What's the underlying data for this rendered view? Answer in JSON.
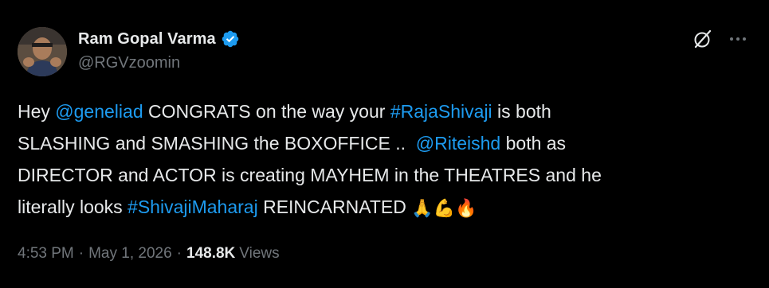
{
  "author": {
    "display_name": "Ram Gopal Varma",
    "handle": "@RGVzoomin",
    "verified": true
  },
  "tweet": {
    "lines": [
      [
        {
          "text": "Hey ",
          "type": "text"
        },
        {
          "text": "@geneliad",
          "type": "link"
        },
        {
          "text": " CONGRATS on the way your ",
          "type": "text"
        },
        {
          "text": "#RajaShivaji",
          "type": "link"
        },
        {
          "text": " is both",
          "type": "text"
        }
      ],
      [
        {
          "text": "SLASHING and SMASHING the BOXOFFICE ..  ",
          "type": "text"
        },
        {
          "text": "@Riteishd",
          "type": "link"
        },
        {
          "text": " both as",
          "type": "text"
        }
      ],
      [
        {
          "text": "DIRECTOR and ACTOR is creating MAYHEM in the THEATRES and he",
          "type": "text"
        }
      ],
      [
        {
          "text": "literally looks ",
          "type": "text"
        },
        {
          "text": "#ShivajiMaharaj",
          "type": "link"
        },
        {
          "text": " REINCARNATED ",
          "type": "text"
        },
        {
          "text": "🙏💪🔥",
          "type": "emoji"
        }
      ]
    ]
  },
  "meta": {
    "time": "4:53 PM",
    "separator": "·",
    "date": "May 1, 2026",
    "views_count": "148.8K",
    "views_label": "Views"
  },
  "icons": {
    "verified": "verified-badge-icon",
    "grok": "grok-icon",
    "more": "more-icon"
  },
  "colors": {
    "background": "#000000",
    "text": "#e7e9ea",
    "muted": "#71767b",
    "link": "#1d9bf0",
    "verified": "#1d9bf0"
  }
}
